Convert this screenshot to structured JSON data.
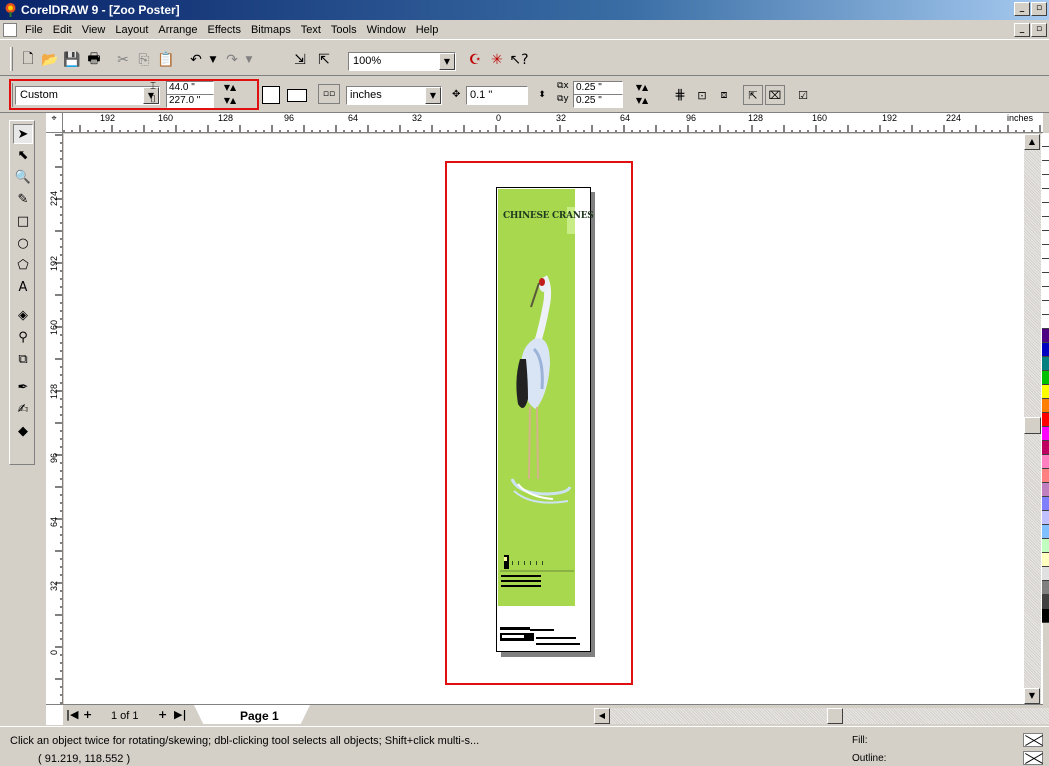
{
  "app": {
    "title": "CorelDRAW 9 - [Zoo Poster]",
    "window_controls": [
      "_",
      "🗗",
      "X"
    ]
  },
  "menu": [
    "File",
    "Edit",
    "View",
    "Layout",
    "Arrange",
    "Effects",
    "Bitmaps",
    "Text",
    "Tools",
    "Window",
    "Help"
  ],
  "toolbar": {
    "zoom_value": "100%"
  },
  "property_bar": {
    "paper_type": "Custom",
    "width": "44.0 \"",
    "height": "227.0 \"",
    "units": "inches",
    "nudge": "0.1 \"",
    "duplicate_x": "0.25 \"",
    "duplicate_y": "0.25 \""
  },
  "ruler": {
    "unit_label": "inches",
    "top_ticks": [
      "192",
      "160",
      "128",
      "96",
      "64",
      "32",
      "0",
      "32",
      "64",
      "96",
      "128",
      "160",
      "192",
      "224"
    ],
    "left_ticks": [
      "224",
      "192",
      "160",
      "128",
      "96",
      "64",
      "32",
      "0"
    ]
  },
  "poster": {
    "title": "CHINESE CRANES",
    "background_color": "#a8d84e"
  },
  "page_nav": {
    "page_count": "1 of 1",
    "page_tab": "Page 1"
  },
  "status": {
    "message": "Click an object twice for rotating/skewing; dbl-clicking tool selects all objects; Shift+click multi-s...",
    "coordinates": "( 91.219, 118.552 )",
    "fill_label": "Fill:",
    "outline_label": "Outline:"
  },
  "palette_colors": [
    "#ffffff",
    "#ffffff",
    "#ffffff",
    "#ffffff",
    "#ffffff",
    "#ffffff",
    "#ffffff",
    "#ffffff",
    "#ffffff",
    "#ffffff",
    "#ffffff",
    "#ffffff",
    "#ffffff",
    "#ffffff",
    "#4b0082",
    "#0000c0",
    "#008080",
    "#00c000",
    "#ffff00",
    "#ff8000",
    "#ff0000",
    "#ff00ff",
    "#c00060",
    "#ff80c0",
    "#ff8080",
    "#c080c0",
    "#8080ff",
    "#c0c0ff",
    "#80c0ff",
    "#c0ffc0",
    "#ffffc0",
    "#e0e0e0",
    "#808080",
    "#404040",
    "#000000"
  ]
}
